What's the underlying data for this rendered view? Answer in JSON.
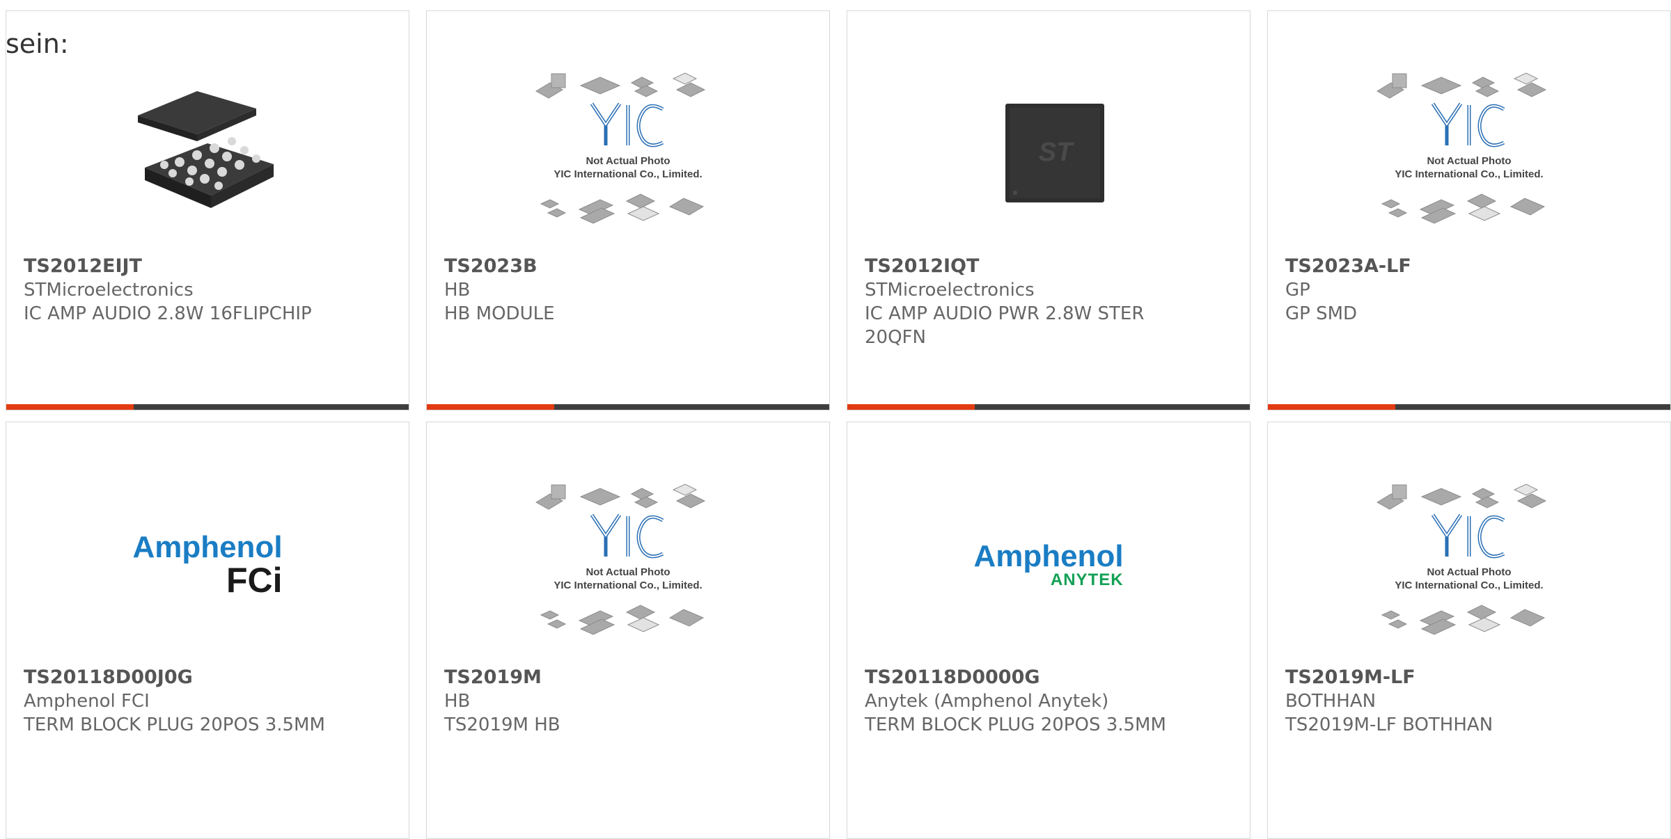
{
  "intro_text": "sein:",
  "colors": {
    "accent": "#e23b12",
    "bar": "#3e3e3e",
    "amphenol_blue": "#1a7dc4",
    "anytek_green": "#12a055",
    "yic_blue": "#2a6fb5"
  },
  "placeholder": {
    "caption_line1": "Not Actual Photo",
    "caption_line2": "YIC International Co., Limited."
  },
  "logos": {
    "amphenol_fci": {
      "line1": "Amphenol",
      "line2": "FCi"
    },
    "amphenol_anytek": {
      "line1": "Amphenol",
      "line2": "ANYTEK"
    }
  },
  "products": [
    {
      "part": "TS2012EIJT",
      "manufacturer": "STMicroelectronics",
      "description": "IC AMP AUDIO 2.8W 16FLIPCHIP",
      "image": "flipchip-ic-image"
    },
    {
      "part": "TS2023B",
      "manufacturer": "HB",
      "description": "HB MODULE",
      "image": "yic-placeholder-image"
    },
    {
      "part": "TS2012IQT",
      "manufacturer": "STMicroelectronics",
      "description": "IC AMP AUDIO PWR 2.8W STER 20QFN",
      "image": "qfn-ic-image"
    },
    {
      "part": "TS2023A-LF",
      "manufacturer": "GP",
      "description": "GP SMD",
      "image": "yic-placeholder-image"
    },
    {
      "part": "TS20118D00J0G",
      "manufacturer": "Amphenol FCI",
      "description": "TERM BLOCK PLUG 20POS 3.5MM",
      "image": "amphenol-fci-logo"
    },
    {
      "part": "TS2019M",
      "manufacturer": "HB",
      "description": "TS2019M HB",
      "image": "yic-placeholder-image"
    },
    {
      "part": "TS20118D0000G",
      "manufacturer": "Anytek (Amphenol Anytek)",
      "description": "TERM BLOCK PLUG 20POS 3.5MM",
      "image": "amphenol-anytek-logo"
    },
    {
      "part": "TS2019M-LF",
      "manufacturer": "BOTHHAN",
      "description": "TS2019M-LF BOTHHAN",
      "image": "yic-placeholder-image"
    }
  ]
}
